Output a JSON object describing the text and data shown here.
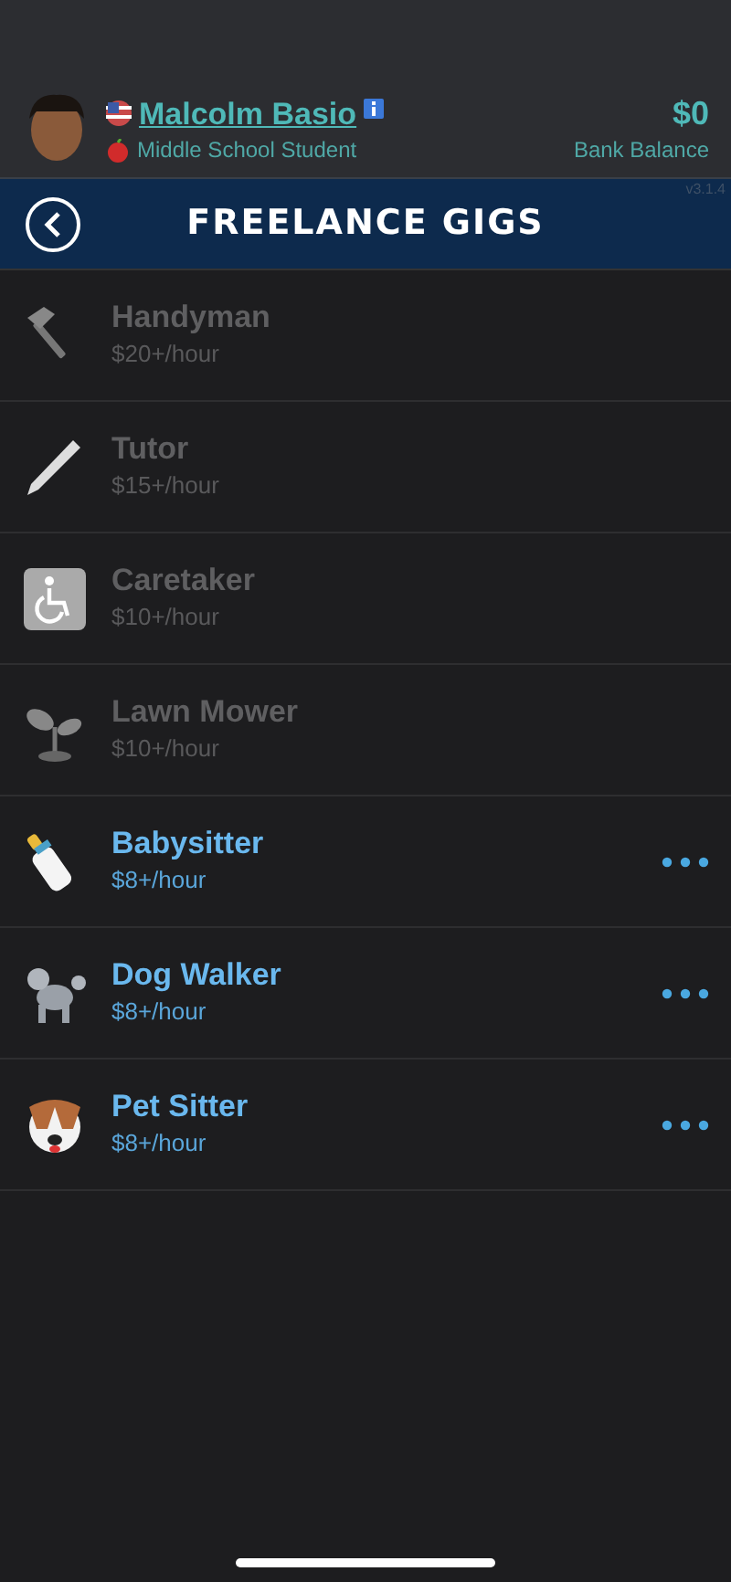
{
  "profile": {
    "name": "Malcolm Basio",
    "status": "Middle School Student",
    "balance": "$0",
    "balance_label": "Bank Balance",
    "version": "v3.1.4"
  },
  "header": {
    "title": "FREELANCE GIGS"
  },
  "gigs": [
    {
      "kind": "hammer",
      "title": "Handyman",
      "rate": "$20+/hour",
      "disabled": true
    },
    {
      "kind": "pencil",
      "title": "Tutor",
      "rate": "$15+/hour",
      "disabled": true
    },
    {
      "kind": "wheelchair",
      "title": "Caretaker",
      "rate": "$10+/hour",
      "disabled": true
    },
    {
      "kind": "sprout",
      "title": "Lawn Mower",
      "rate": "$10+/hour",
      "disabled": true
    },
    {
      "kind": "bottle",
      "title": "Babysitter",
      "rate": "$8+/hour",
      "disabled": false
    },
    {
      "kind": "poodle",
      "title": "Dog Walker",
      "rate": "$8+/hour",
      "disabled": false
    },
    {
      "kind": "dog",
      "title": "Pet Sitter",
      "rate": "$8+/hour",
      "disabled": false
    }
  ]
}
